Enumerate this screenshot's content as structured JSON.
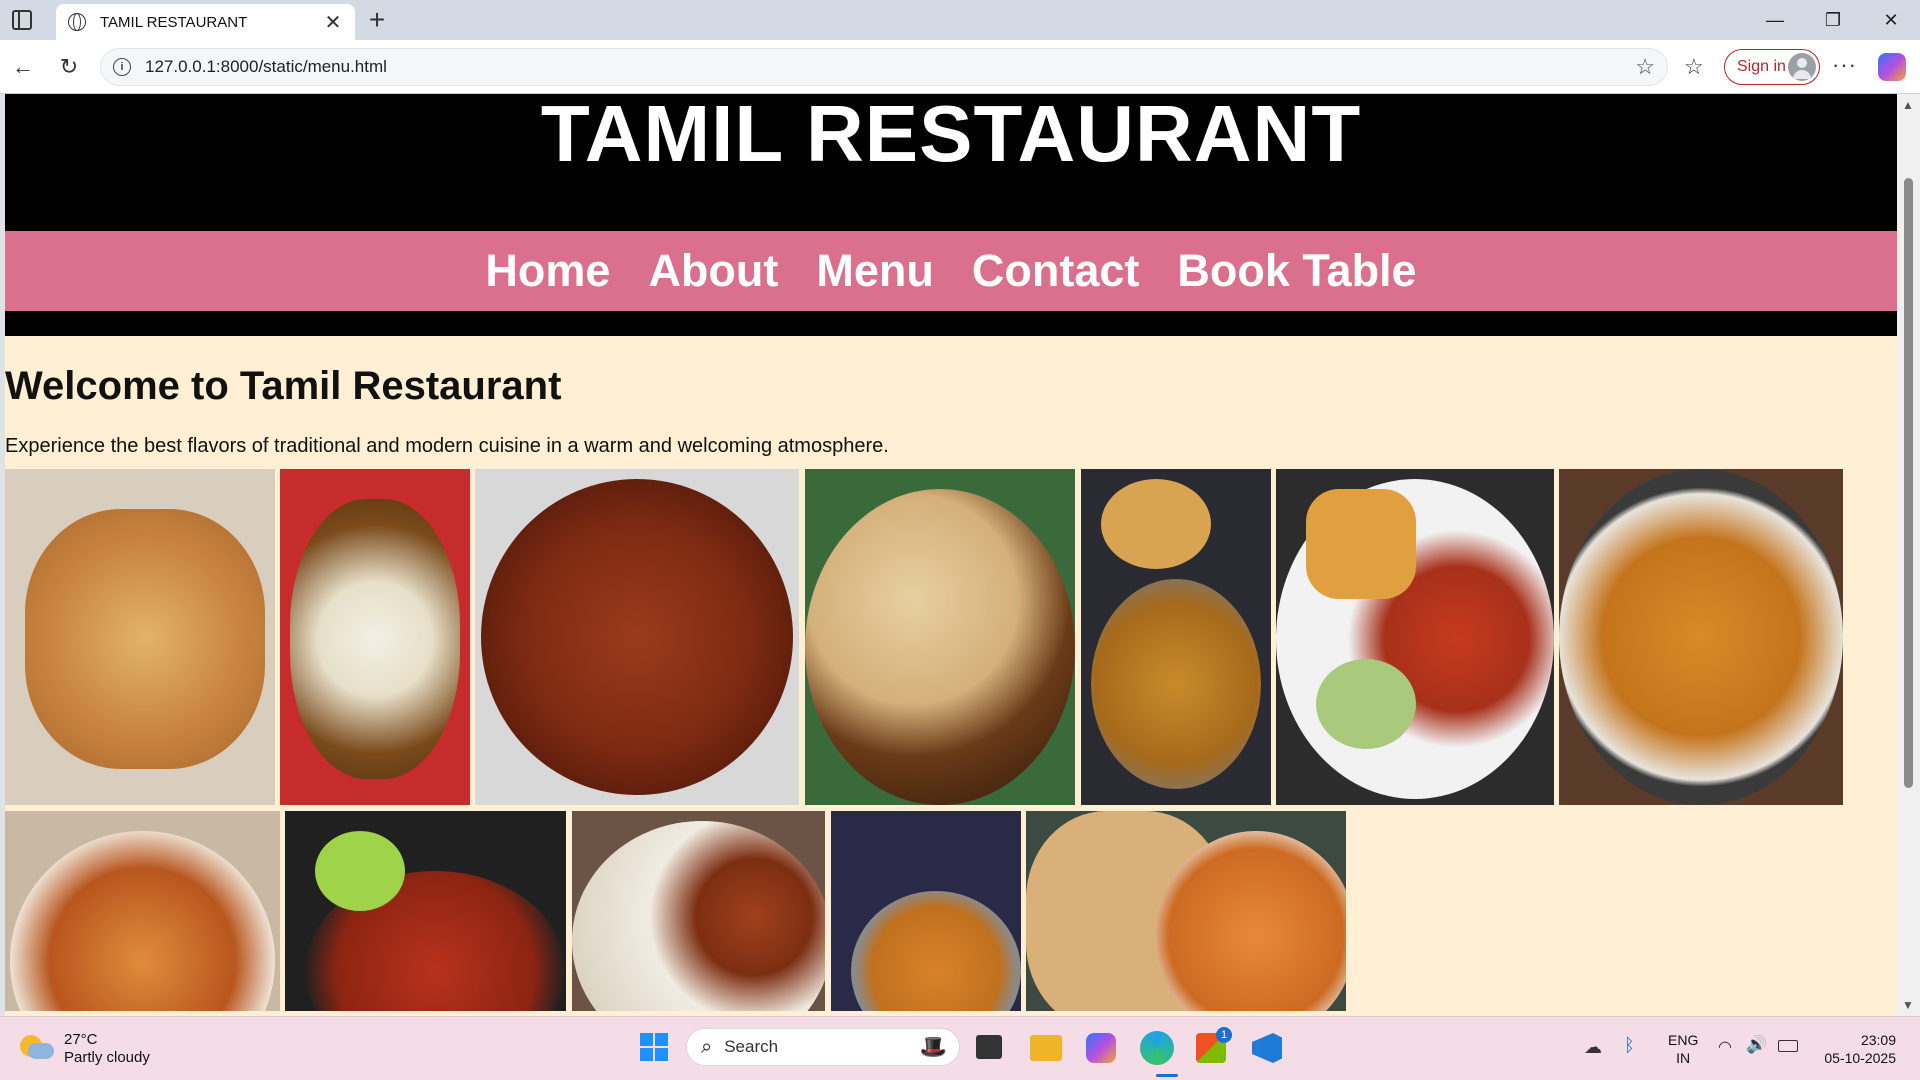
{
  "browser": {
    "tab_title": "TAMIL RESTAURANT",
    "url": "127.0.0.1:8000/static/menu.html",
    "sign_in_label": "Sign in"
  },
  "page": {
    "hero_title": "TAMIL RESTAURANT",
    "nav": [
      "Home",
      "About",
      "Menu",
      "Contact",
      "Book Table"
    ],
    "welcome_heading": "Welcome to Tamil Restaurant",
    "welcome_text": "Experience the best flavors of traditional and modern cuisine in a warm and welcoming atmosphere.",
    "colors": {
      "page_bg": "#ffefd5",
      "nav_bg": "#db6f8e",
      "hero_bg": "#000000"
    },
    "gallery_images": [
      "pizza-photo",
      "egg-curry-photo",
      "mutton-curry-photo",
      "paratha-paneer-photo",
      "puri-sabzi-photo",
      "pav-bhaji-photo",
      "fusilli-pasta-photo",
      "matar-paneer-photo",
      "chicken-lollipop-photo",
      "biryani-chicken-photo",
      "pasta-pan-photo",
      "naan-butter-chicken-photo"
    ]
  },
  "taskbar": {
    "weather_temp": "27°C",
    "weather_desc": "Partly cloudy",
    "search_placeholder": "Search",
    "lang_line1": "ENG",
    "lang_line2": "IN",
    "time": "23:09",
    "date": "05-10-2025",
    "store_badge": "1"
  }
}
